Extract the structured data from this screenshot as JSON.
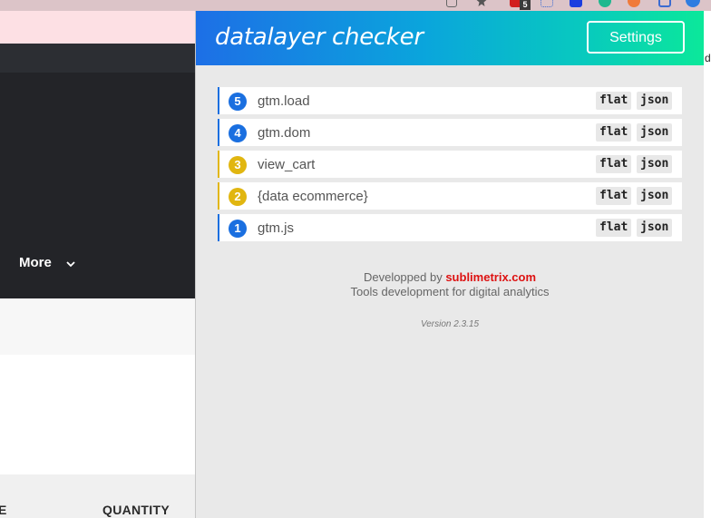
{
  "browser": {
    "extension_badge": "5"
  },
  "website": {
    "nav_more_label": "More",
    "column_headers": [
      "E",
      "QUANTITY"
    ],
    "right_edge_text": "d"
  },
  "popup": {
    "title": "datalayer checker",
    "settings_label": "Settings",
    "events": [
      {
        "number": "5",
        "name": "gtm.load",
        "color": "blue",
        "flat_label": "flat",
        "json_label": "json"
      },
      {
        "number": "4",
        "name": "gtm.dom",
        "color": "blue",
        "flat_label": "flat",
        "json_label": "json"
      },
      {
        "number": "3",
        "name": "view_cart",
        "color": "yellow",
        "flat_label": "flat",
        "json_label": "json"
      },
      {
        "number": "2",
        "name": "{data ecommerce}",
        "color": "yellow",
        "flat_label": "flat",
        "json_label": "json"
      },
      {
        "number": "1",
        "name": "gtm.js",
        "color": "blue",
        "flat_label": "flat",
        "json_label": "json"
      }
    ],
    "footer": {
      "developed_by": "Developped by",
      "brand": "sublimetrix.com",
      "tagline": "Tools development for digital analytics"
    },
    "version": "Version 2.3.15"
  },
  "colors": {
    "header_gradient_start": "#1d6fe6",
    "header_gradient_end": "#0be89a",
    "event_blue": "#1a6fe0",
    "event_yellow": "#e1b610",
    "brand_red": "#dd1111"
  }
}
